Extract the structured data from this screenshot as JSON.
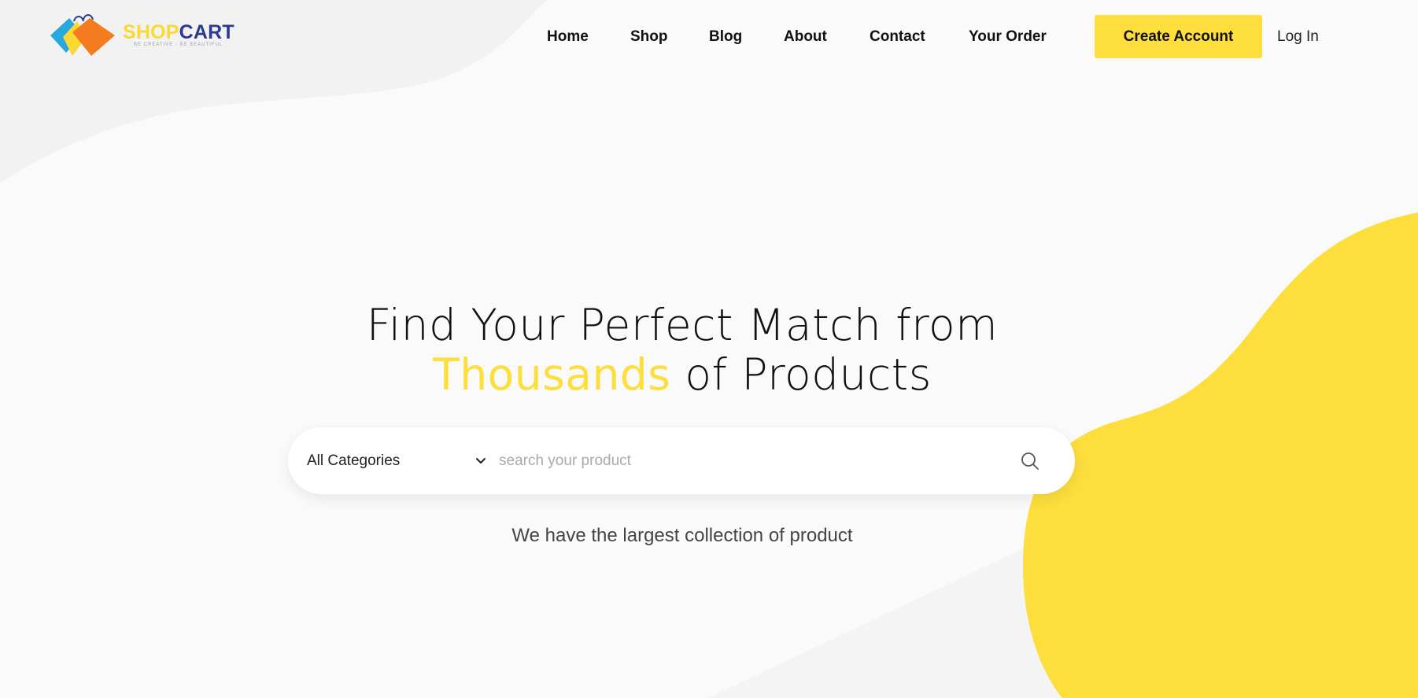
{
  "brand": {
    "name_part1": "SHOP",
    "name_part2": "CART",
    "tagline": "BE CREATIVE · BE BEAUTIFUL",
    "colors": {
      "yellow": "#fdde3c",
      "navy": "#2b3990",
      "orange": "#f47b20",
      "blue": "#29a8e0"
    }
  },
  "nav": {
    "items": [
      {
        "label": "Home"
      },
      {
        "label": "Shop"
      },
      {
        "label": "Blog"
      },
      {
        "label": "About"
      },
      {
        "label": "Contact"
      },
      {
        "label": "Your Order"
      }
    ],
    "create_account": "Create Account",
    "login": "Log In"
  },
  "hero": {
    "title_line1": "Find Your Perfect Match from",
    "title_accent": "Thousands",
    "title_line2_rest": " of Products",
    "subtitle": "We have the largest collection of product",
    "accent_color": "#fdde3c"
  },
  "search": {
    "category_value": "All Categories",
    "placeholder": "search your product",
    "icon": "search-icon"
  }
}
